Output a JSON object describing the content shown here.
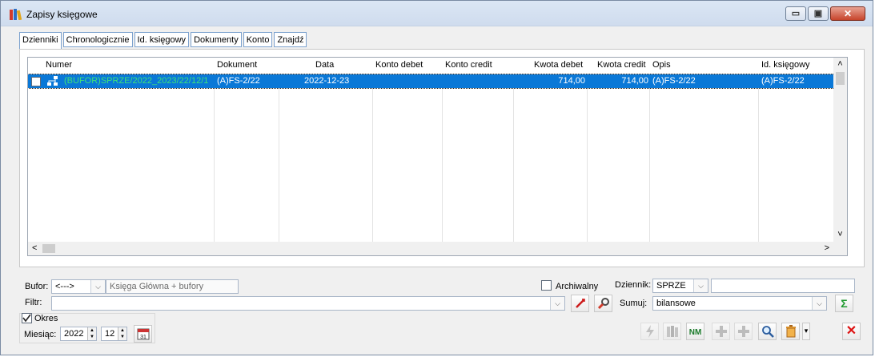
{
  "window": {
    "title": "Zapisy księgowe",
    "minimize_glyph": "▭",
    "maximize_glyph": "▣",
    "close_glyph": "✕"
  },
  "tabs": [
    {
      "label": "Dzienniki",
      "active": true
    },
    {
      "label": "Chronologicznie"
    },
    {
      "label": "Id. księgowy"
    },
    {
      "label": "Dokumenty"
    },
    {
      "label": "Konto"
    },
    {
      "label": "Znajdź"
    }
  ],
  "grid": {
    "columns": [
      "Numer",
      "Dokument",
      "Data",
      "Konto debet",
      "Konto credit",
      "Kwota debet",
      "Kwota credit",
      "Opis",
      "Id. księgowy"
    ],
    "rows": [
      {
        "numer": "(BUFOR)SPRZE/2022_2023/22/12/1",
        "dokument": "(A)FS-2/22",
        "data": "2022-12-23",
        "konto_debet": "",
        "konto_credit": "",
        "kwota_debet": "714,00",
        "kwota_credit": "714,00",
        "opis": "(A)FS-2/22",
        "id_ksiegowy": "(A)FS-2/22"
      }
    ],
    "numer_color": "#3ee07a",
    "selection_color": "#0a78d7",
    "scroll_up": "˄",
    "scroll_down": "˅",
    "scroll_left": "<",
    "scroll_right": ">"
  },
  "filters": {
    "bufor_label": "Bufor:",
    "bufor_value": "<--->",
    "bufor_desc": "Księga Główna + bufory",
    "archiwalny_label": "Archiwalny",
    "dziennik_label": "Dziennik:",
    "dziennik_value": "SPRZE",
    "dziennik_extra": "",
    "filtr_label": "Filtr:",
    "filtr_value": "",
    "sumuj_label": "Sumuj:",
    "sumuj_value": "bilansowe",
    "okres_label": "Okres",
    "okres_checked": true,
    "miesiac_label": "Miesiąc:",
    "year": "2022",
    "month": "12"
  },
  "icons": {
    "app": "books-icon",
    "sigma": "Σ",
    "calendar": "31"
  },
  "toolbar": {
    "nm_label": "NM",
    "dropdown_glyph": "▾",
    "close_glyph": "✕"
  }
}
